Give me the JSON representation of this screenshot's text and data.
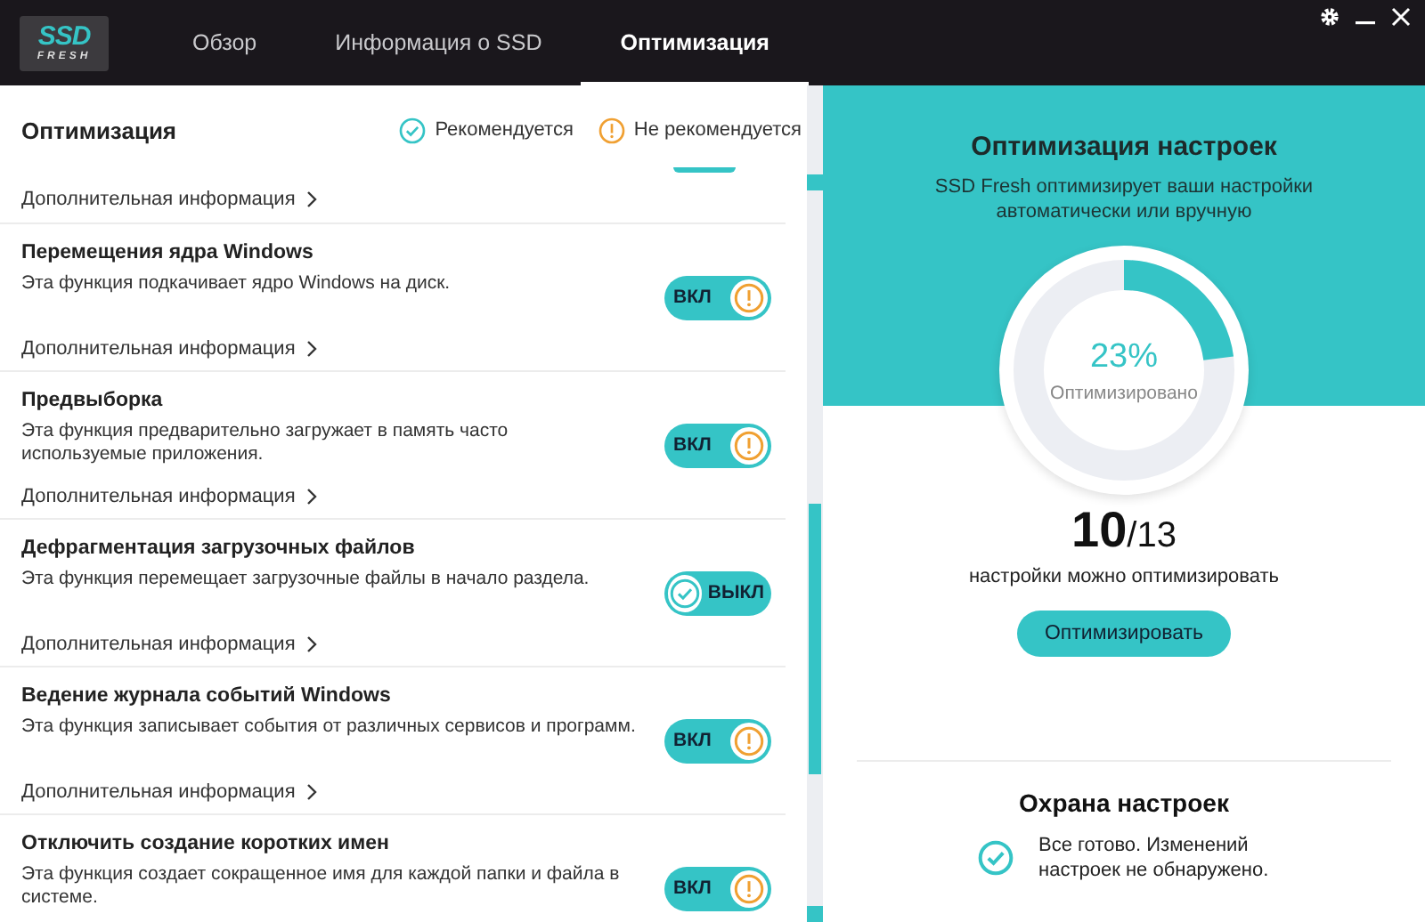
{
  "logo": {
    "top": "SSD",
    "bottom": "FRESH"
  },
  "tabs": [
    {
      "label": "Обзор",
      "selected": false
    },
    {
      "label": "Информация о SSD",
      "selected": false
    },
    {
      "label": "Оптимизация",
      "selected": true
    }
  ],
  "section": {
    "title": "Оптимизация",
    "legend": [
      {
        "kind": "ok",
        "label": "Рекомендуется"
      },
      {
        "kind": "warn",
        "label": "Не рекомендуется"
      }
    ]
  },
  "top_link": "Дополнительная информация",
  "settings": [
    {
      "title": "Перемещения ядра Windows",
      "description": "Эта функция подкачивает ядро Windows на диск.",
      "link": "Дополнительная информация",
      "on": true,
      "toggle_label": "ВКЛ"
    },
    {
      "title": "Предвыборка",
      "description": "Эта функция предварительно загружает в память часто используемые приложения.",
      "link": "Дополнительная информация",
      "on": true,
      "toggle_label": "ВКЛ"
    },
    {
      "title": "Дефрагментация загрузочных файлов",
      "description": "Эта функция перемещает загрузочные файлы в начало раздела.",
      "link": "Дополнительная информация",
      "on": false,
      "toggle_label": "ВЫКЛ"
    },
    {
      "title": "Ведение журнала событий Windows",
      "description": "Эта функция записывает события от различных сервисов и программ.",
      "link": "Дополнительная информация",
      "on": true,
      "toggle_label": "ВКЛ"
    },
    {
      "title": "Отключить создание коротких имен",
      "description": "Эта функция создает сокращенное имя для каждой папки и файла в системе.",
      "on": true,
      "toggle_label": "ВКЛ"
    }
  ],
  "summary": {
    "title": "Оптимизация настроек",
    "subtitle": "SSD Fresh оптимизирует ваши настройки автоматически или вручную",
    "percent": "23%",
    "percent_label": "Оптимизировано",
    "level": 0.23,
    "count": "10",
    "total": "/13",
    "count_label": "настройки можно оптимизировать",
    "button": "Оптимизировать"
  },
  "protection": {
    "title": "Охрана настроек",
    "message": "Все готово. Изменений настроек не обнаружено."
  }
}
